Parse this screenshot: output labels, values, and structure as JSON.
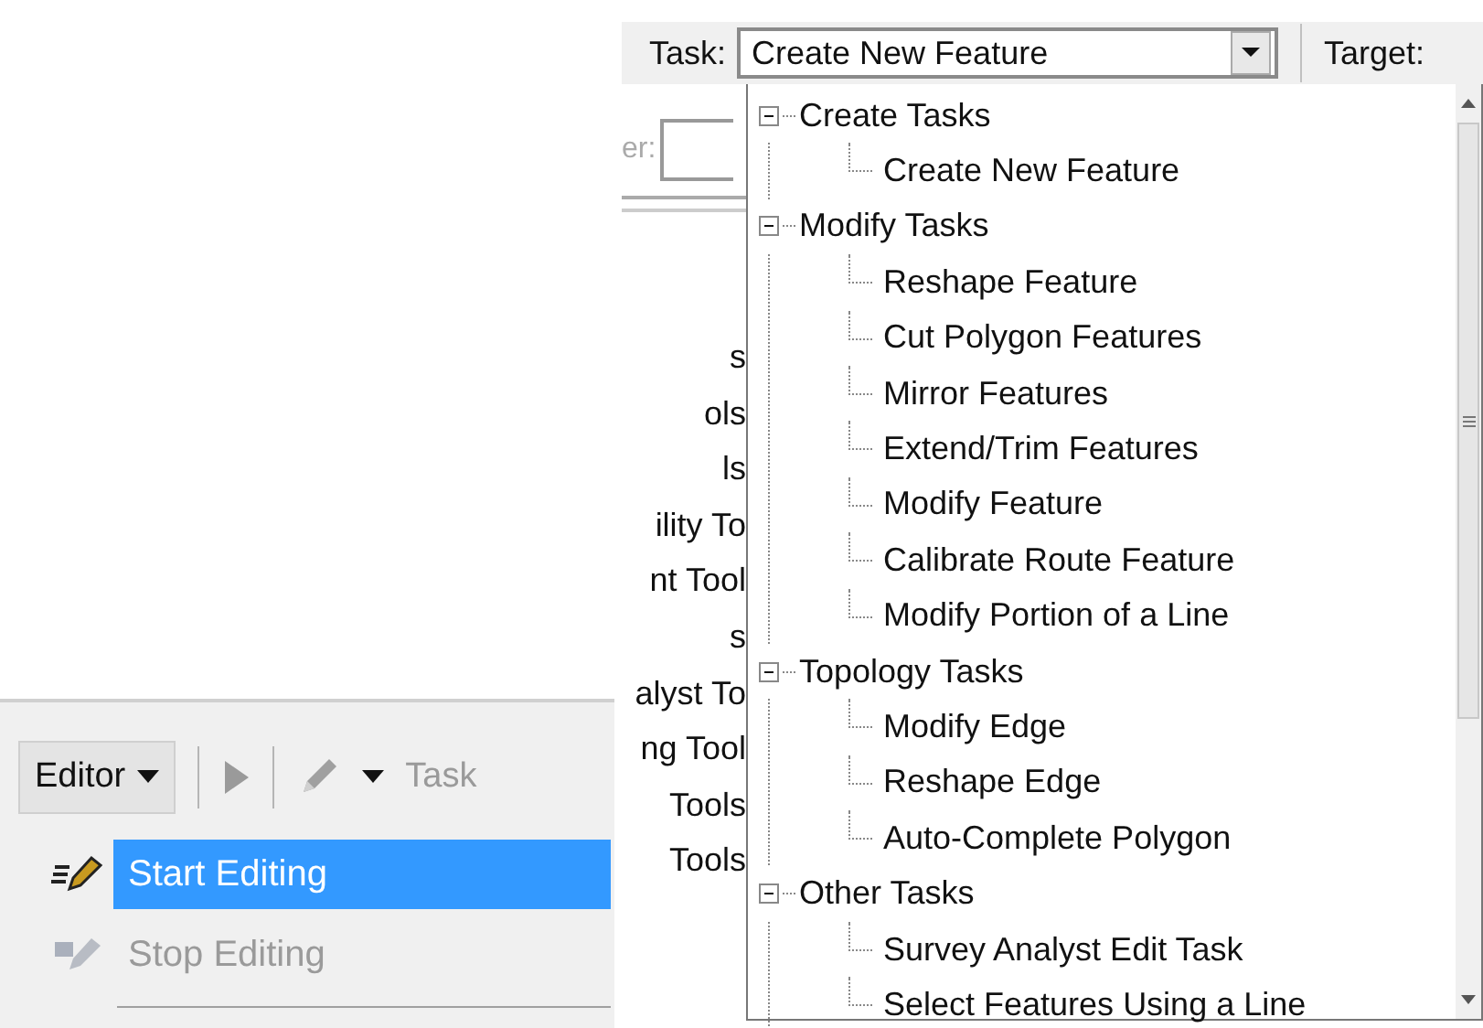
{
  "editor_panel": {
    "editor_menu": "Editor",
    "task_label": "Task",
    "menu": [
      {
        "label": "Start Editing",
        "selected": true,
        "disabled": false
      },
      {
        "label": "Stop Editing",
        "selected": false,
        "disabled": true
      }
    ]
  },
  "task_panel": {
    "task_label": "Task:",
    "task_value": "Create New Feature",
    "target_label": "Target:",
    "side_label": "er:",
    "side_texts": [
      "s",
      "ols",
      "ls",
      "ility To",
      "nt Tool",
      "s",
      "alyst To",
      "ng Tool",
      "Tools",
      "Tools"
    ],
    "task_tree": [
      {
        "label": "Create Tasks",
        "expanded": true,
        "children": [
          {
            "label": "Create New Feature"
          }
        ]
      },
      {
        "label": "Modify Tasks",
        "expanded": true,
        "children": [
          {
            "label": "Reshape Feature"
          },
          {
            "label": "Cut Polygon Features"
          },
          {
            "label": "Mirror Features"
          },
          {
            "label": "Extend/Trim Features"
          },
          {
            "label": "Modify Feature"
          },
          {
            "label": "Calibrate Route Feature"
          },
          {
            "label": "Modify Portion of a Line"
          }
        ]
      },
      {
        "label": "Topology Tasks",
        "expanded": true,
        "children": [
          {
            "label": "Modify Edge"
          },
          {
            "label": "Reshape Edge"
          },
          {
            "label": "Auto-Complete Polygon"
          }
        ]
      },
      {
        "label": "Other Tasks",
        "expanded": true,
        "children": [
          {
            "label": "Survey Analyst Edit Task"
          },
          {
            "label": "Select Features Using a Line"
          }
        ]
      }
    ]
  }
}
